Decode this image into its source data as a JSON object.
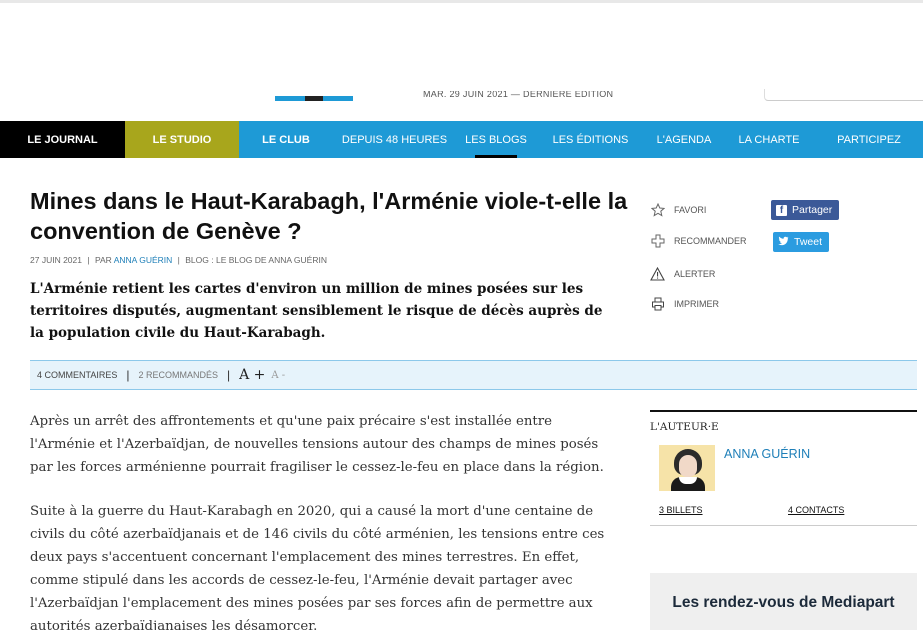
{
  "header": {
    "edition_line": "MAR. 29 JUIN 2021 — DERNIÈRE ÉDITION"
  },
  "nav": {
    "items": [
      {
        "label": "LE JOURNAL"
      },
      {
        "label": "LE STUDIO"
      },
      {
        "label": "LE CLUB"
      },
      {
        "label": "DEPUIS 48 HEURES"
      },
      {
        "label": "LES BLOGS"
      },
      {
        "label": "LES ÉDITIONS"
      },
      {
        "label": "L'AGENDA"
      },
      {
        "label": "LA CHARTE"
      },
      {
        "label": "PARTICIPEZ"
      }
    ],
    "active": "LES BLOGS",
    "colors": {
      "bar": "#1e9ad6",
      "journal": "#000000",
      "studio": "#a8a61c"
    }
  },
  "article": {
    "title": "Mines dans le Haut-Karabagh, l'Arménie viole-t-elle la convention de Genève ?",
    "date": "27 JUIN 2021",
    "by_prefix": "PAR",
    "author": "ANNA GUÉRIN",
    "blog_prefix": "BLOG :",
    "blog": "LE BLOG DE ANNA GUÉRIN",
    "lead": "L'Arménie retient les cartes d'environ un million de mines posées sur les territoires disputés, augmentant sensiblement le risque de décès auprès de la population civile du Haut-Karabagh.",
    "paragraphs": [
      "Après un arrêt des affrontements et qu'une paix précaire s'est installée entre l'Arménie et l'Azerbaïdjan, de nouvelles tensions autour des champs de mines posés par les forces arménienne pourrait fragiliser le cessez-le-feu en place dans la région.",
      "Suite à la guerre du Haut-Karabagh en 2020, qui a causé la mort d'une centaine de civils du côté azerbaïdjanais et de 146 civils du côté arménien, les tensions entre ces deux pays s'accentuent concernant l'emplacement des mines terrestres. En effet, comme stipulé dans les accords de cessez-le-feu, l'Arménie devait partager avec l'Azerbaïdjan l'emplacement des mines posées par ses forces afin de permettre aux autorités azerbaïdjanaises les désamorcer."
    ]
  },
  "actions": {
    "favori": "FAVORI",
    "recommander": "RECOMMANDER",
    "alerter": "ALERTER",
    "imprimer": "IMPRIMER",
    "share_facebook": "Partager",
    "share_twitter": "Tweet",
    "facebook_glyph": "f",
    "twitter_glyph": "🐦"
  },
  "toolbar": {
    "comments": "4 COMMENTAIRES",
    "recommended": "2 RECOMMANDÉS",
    "font_bigger": "A +",
    "font_smaller": "A -"
  },
  "sidebar": {
    "author_heading": "L'AUTEUR·E",
    "author_name": "ANNA GUÉRIN",
    "billets": "3 BILLETS",
    "contacts": "4 CONTACTS",
    "rdv_title": "Les rendez-vous de Mediapart"
  }
}
